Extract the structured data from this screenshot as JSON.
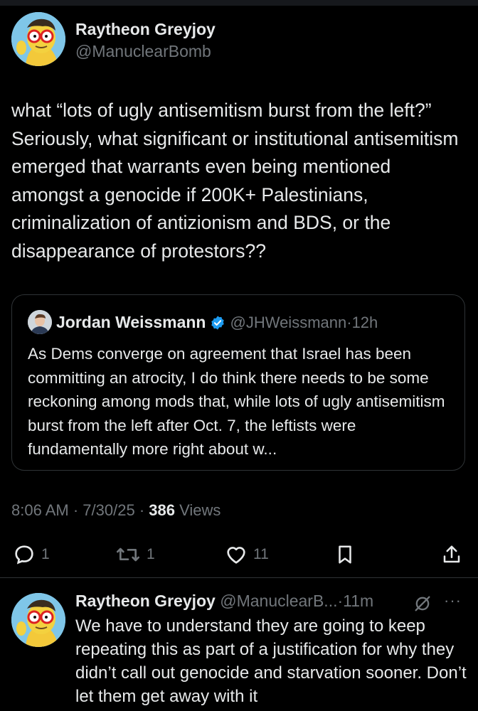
{
  "main_tweet": {
    "author_name": "Raytheon Greyjoy",
    "author_handle": "@ManuclearBomb",
    "text": "what “lots of ugly antisemitism burst from the left?” Seriously, what significant or institutional antisemitism emerged that warrants even being mentioned amongst a genocide if 200K+ Palestinians, criminalization of antizionism and BDS, or the disappearance of protestors??",
    "time": "8:06 AM",
    "date": "7/30/25",
    "views_count": "386",
    "views_label": "Views",
    "separator": "·"
  },
  "quoted_tweet": {
    "author_name": "Jordan Weissmann",
    "author_handle": "@JHWeissmann",
    "separator": "·",
    "age": "12h",
    "text": "As Dems converge on agreement that Israel has been committing an atrocity, I do think there needs to be some reckoning among mods that, while lots of ugly antisemitism burst from the left after Oct. 7, the leftists were fundamentally more right about w..."
  },
  "actions": {
    "replies": "1",
    "retweets": "1",
    "likes": "11"
  },
  "reply": {
    "author_name": "Raytheon Greyjoy",
    "author_handle": "@ManuclearB...",
    "separator": "·",
    "age": "11m",
    "more": "···",
    "text": "We have to understand they are going to keep repeating this as part of a justification for why they didn’t call out genocide and starvation sooner. Don’t let them get away with it"
  },
  "icons": [
    "reply-icon",
    "retweet-icon",
    "like-icon",
    "bookmark-icon",
    "share-icon",
    "verified-badge-icon",
    "grok-icon",
    "more-icon"
  ],
  "colors": {
    "background": "#000000",
    "text": "#e7e9ea",
    "muted": "#71767b",
    "verified": "#1d9bf0",
    "border": "#2f3336"
  }
}
